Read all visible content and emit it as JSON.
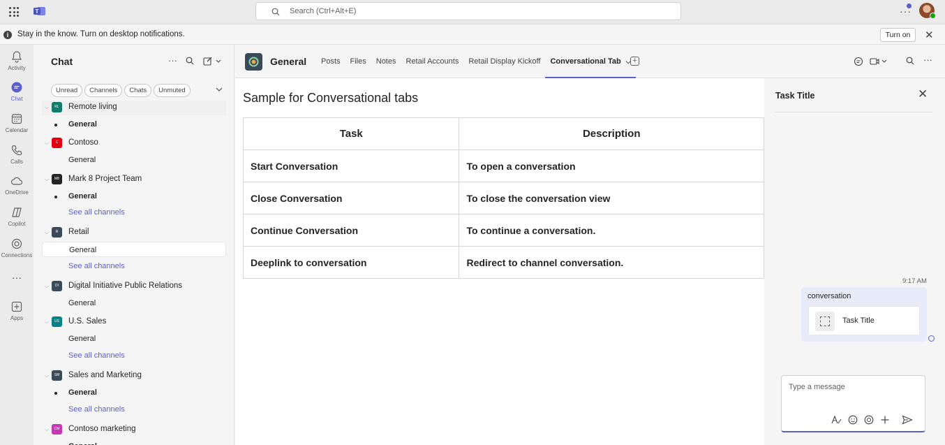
{
  "topbar": {
    "search_placeholder": "Search (Ctrl+Alt+E)",
    "more": "···"
  },
  "notification": {
    "message": "Stay in the know. Turn on desktop notifications.",
    "turn_on": "Turn on"
  },
  "rail": [
    {
      "label": "Activity",
      "icon": "bell-icon"
    },
    {
      "label": "Chat",
      "icon": "chat-icon",
      "active": true
    },
    {
      "label": "Calendar",
      "icon": "calendar-icon"
    },
    {
      "label": "Calls",
      "icon": "phone-icon"
    },
    {
      "label": "OneDrive",
      "icon": "cloud-icon"
    },
    {
      "label": "Copilot",
      "icon": "copilot-icon"
    },
    {
      "label": "Connections",
      "icon": "connections-icon"
    },
    {
      "label": "···",
      "icon": "more-icon"
    },
    {
      "label": "Apps",
      "icon": "apps-icon"
    }
  ],
  "chatpane": {
    "title": "Chat",
    "filters": [
      "Unread",
      "Channels",
      "Chats",
      "Unmuted"
    ],
    "teams": [
      {
        "name": "Remote living",
        "initials": "RL",
        "color": "#0f7b6c"
      },
      {
        "name": "Contoso",
        "initials": "C",
        "color": "#e3000f"
      },
      {
        "name": "Mark 8 Project Team",
        "initials": "M8",
        "color": "#242424"
      },
      {
        "name": "Retail",
        "initials": "R",
        "color": "#3b4a58"
      },
      {
        "name": "Digital Initiative Public Relations",
        "initials": "DI",
        "color": "#3b4a58"
      },
      {
        "name": "U.S. Sales",
        "initials": "US",
        "color": "#038387"
      },
      {
        "name": "Sales and Marketing",
        "initials": "SM",
        "color": "#3b4a58"
      },
      {
        "name": "Contoso marketing",
        "initials": "CM",
        "color": "#c239b3"
      }
    ],
    "channels": {
      "general": "General",
      "see_all": "See all channels"
    }
  },
  "channel": {
    "title": "General",
    "tabs": [
      "Posts",
      "Files",
      "Notes",
      "Retail Accounts",
      "Retail Display Kickoff",
      "Conversational Tab"
    ],
    "active_tab": "Conversational Tab"
  },
  "content": {
    "title": "Sample for Conversational tabs",
    "table": {
      "headers": [
        "Task",
        "Description"
      ],
      "rows": [
        [
          "Start Conversation",
          "To open a conversation"
        ],
        [
          "Close Conversation",
          "To close the conversation view"
        ],
        [
          "Continue Conversation",
          "To continue a conversation."
        ],
        [
          "Deeplink to conversation",
          "Redirect to channel conversation."
        ]
      ]
    }
  },
  "conversation": {
    "title": "Task Title",
    "time": "9:17 AM",
    "message_text": "conversation",
    "card_title": "Task Title",
    "composer_placeholder": "Type a message"
  },
  "colors": {
    "accent": "#5b5fc7",
    "rail_bg": "#ebebeb",
    "panel_bg": "#f5f5f5"
  }
}
